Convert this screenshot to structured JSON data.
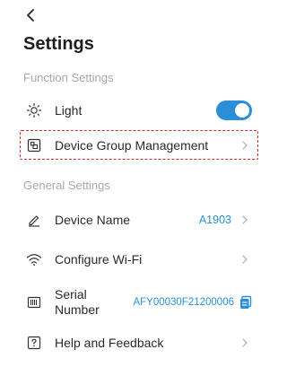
{
  "header": {
    "back_icon": "chevron-left-icon",
    "title": "Settings"
  },
  "function_settings": {
    "section_label": "Function Settings",
    "light": {
      "label": "Light",
      "icon": "sun-icon",
      "enabled": true
    },
    "device_group": {
      "label": "Device Group Management",
      "icon": "device-group-icon",
      "highlighted": true
    }
  },
  "general_settings": {
    "section_label": "General Settings",
    "device_name": {
      "label": "Device Name",
      "value": "A1903",
      "icon": "pencil-icon"
    },
    "wifi": {
      "label": "Configure Wi-Fi",
      "icon": "wifi-icon"
    },
    "serial": {
      "label_line1": "Serial",
      "label_line2": "Number",
      "value": "AFY00030F21200006",
      "icon": "barcode-icon",
      "copy_icon": "copy-icon"
    },
    "help": {
      "label": "Help and Feedback",
      "icon": "help-icon"
    }
  },
  "colors": {
    "accent": "#2a8fd6",
    "highlight_border": "#d22b2b",
    "section_text": "#a8a8a8"
  }
}
